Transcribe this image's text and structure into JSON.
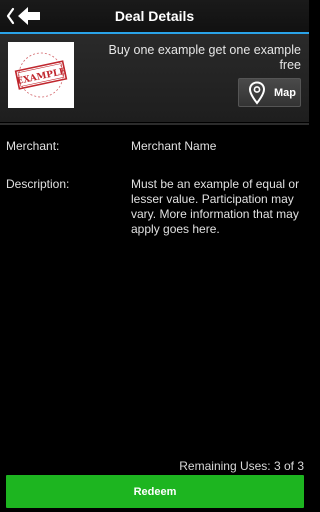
{
  "header": {
    "title": "Deal Details",
    "back_icon": "chevron-left-arrow-icon"
  },
  "deal": {
    "title": "Buy one example get one example free",
    "logo_text": "EXAMPLE",
    "map_label": "Map"
  },
  "details": {
    "merchant_label": "Merchant:",
    "merchant_value": "Merchant Name",
    "description_label": "Description:",
    "description_value": "Must be an example of equal or lesser value. Participation may vary. More information that may apply goes here."
  },
  "footer": {
    "remaining_uses": "Remaining Uses: 3 of 3",
    "redeem_label": "Redeem"
  },
  "colors": {
    "accent": "#2aa3e8",
    "redeem": "#1db520",
    "stamp_red": "#c0262d"
  }
}
